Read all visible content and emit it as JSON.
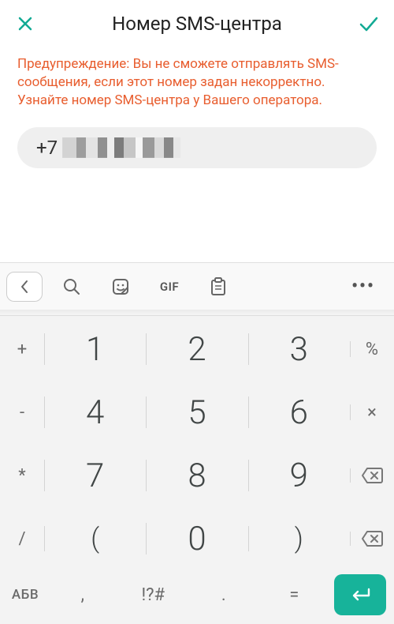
{
  "header": {
    "title": "Номер SMS-центра"
  },
  "content": {
    "warning_text": "Предупреждение: Вы не сможете отправлять SMS-сообщения, если этот номер задан некорректно. Узнайте номер SMS-центра у Вашего оператора.",
    "input_prefix": "+7"
  },
  "strip": {
    "gif_label": "GIF"
  },
  "numpad": {
    "r1": {
      "left": "+",
      "k1": "1",
      "k2": "2",
      "k3": "3",
      "right": "%"
    },
    "r2": {
      "left": "-",
      "k1": "4",
      "k2": "5",
      "k3": "6",
      "right": "×"
    },
    "r3": {
      "left": "*",
      "k1": "7",
      "k2": "8",
      "k3": "9",
      "right": ""
    },
    "r4": {
      "left": "/",
      "k1": "(",
      "k2": "0",
      "k3": ")",
      "right": ""
    }
  },
  "bottom": {
    "abc": "АБВ",
    "comma": ",",
    "sym": "!?#",
    "dot": ".",
    "eq": "="
  }
}
